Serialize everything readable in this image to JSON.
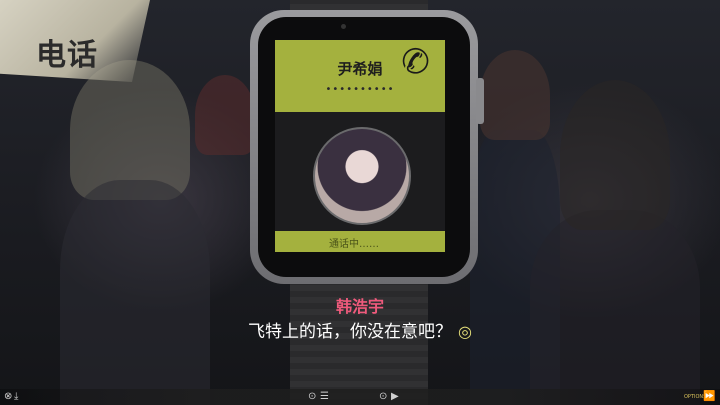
{
  "scene": {
    "badge_label": "电话"
  },
  "watch": {
    "caller_name": "尹希娟",
    "caller_dots": "••••••••••",
    "status_text": "通话中……"
  },
  "dialogue": {
    "speaker": "韩浩宇",
    "text": "飞特上的话，你没在意吧？"
  },
  "controls": {
    "options_label": "OPTIONS"
  },
  "colors": {
    "accent_green": "#a4b13e",
    "speaker_pink": "#ef5a7c"
  }
}
